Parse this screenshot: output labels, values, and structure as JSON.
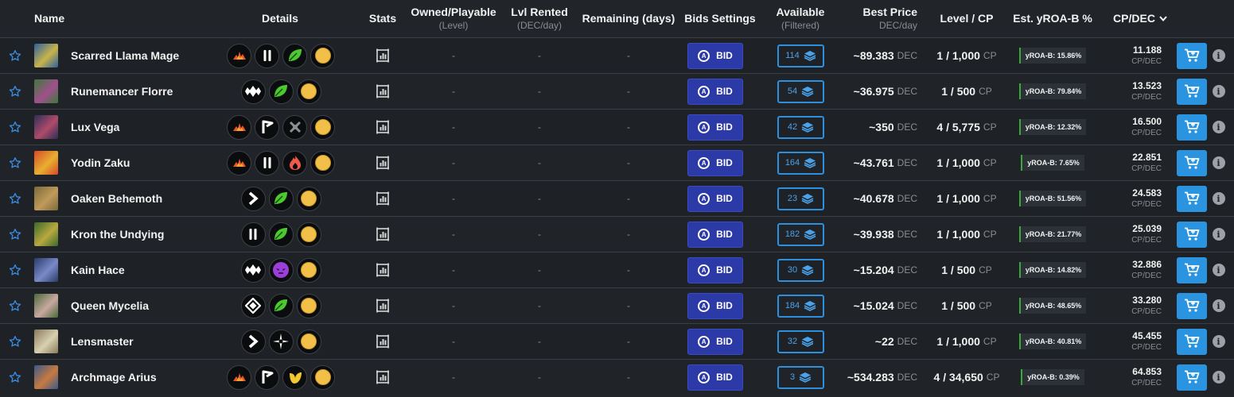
{
  "header": {
    "name": "Name",
    "details": "Details",
    "stats": "Stats",
    "owned": "Owned/Playable",
    "owned_sub": "(Level)",
    "lvl_rented": "Lvl Rented",
    "lvl_rented_sub": "(DEC/day)",
    "remaining": "Remaining (days)",
    "bids_settings": "Bids Settings",
    "available": "Available",
    "available_sub": "(Filtered)",
    "best_price": "Best Price",
    "best_price_sub": "DEC/day",
    "level_cp": "Level / CP",
    "yroa": "Est. yROA-B %",
    "cpdec": "CP/DEC"
  },
  "labels": {
    "dash": "-",
    "bid": "BID",
    "dec_unit": "DEC",
    "cp_unit": "CP",
    "cpdec_unit": "CP/DEC",
    "info": "i"
  },
  "colors": {
    "accent_blue": "#2a94e0",
    "bid_button": "#2c3aa8",
    "yroa_bar": "#3ca83c"
  },
  "rows": [
    {
      "name": "Scarred Llama Mage",
      "thumb": [
        "#2d5fa0",
        "#c8b44a"
      ],
      "icons": [
        "fire-splinter-icon",
        "attack-melee-icon",
        "earth-splinter-icon",
        "gold-rarity-icon"
      ],
      "available": "114",
      "price": "~89.383",
      "level": "1 / 1,000",
      "yroa": "yROA-B: 15.86%",
      "cpdec": "11.188"
    },
    {
      "name": "Runemancer Florre",
      "thumb": [
        "#3c7a3a",
        "#a0508c"
      ],
      "icons": [
        "magic-attack-icon",
        "earth-splinter-icon",
        "gold-rarity-icon"
      ],
      "available": "54",
      "price": "~36.975",
      "level": "1 / 500",
      "yroa": "yROA-B: 79.84%",
      "cpdec": "13.523"
    },
    {
      "name": "Lux Vega",
      "thumb": [
        "#2b2f58",
        "#b04a6a"
      ],
      "icons": [
        "fire-splinter-icon",
        "ranged-attack-icon",
        "neutral-splinter-icon",
        "gold-rarity-icon"
      ],
      "available": "42",
      "price": "~350",
      "level": "4 / 5,775",
      "yroa": "yROA-B: 12.32%",
      "cpdec": "16.500"
    },
    {
      "name": "Yodin Zaku",
      "thumb": [
        "#d8482a",
        "#e8b030"
      ],
      "icons": [
        "fire-splinter-icon",
        "attack-melee-icon",
        "fire-element-icon",
        "gold-rarity-icon"
      ],
      "available": "164",
      "price": "~43.761",
      "level": "1 / 1,000",
      "yroa": "yROA-B: 7.65%",
      "cpdec": "22.851"
    },
    {
      "name": "Oaken Behemoth",
      "thumb": [
        "#7a6a3a",
        "#c09a5a"
      ],
      "icons": [
        "speed-icon",
        "earth-splinter-icon",
        "gold-rarity-icon"
      ],
      "available": "23",
      "price": "~40.678",
      "level": "1 / 1,000",
      "yroa": "yROA-B: 51.56%",
      "cpdec": "24.583"
    },
    {
      "name": "Kron the Undying",
      "thumb": [
        "#3a6a2a",
        "#b8a840"
      ],
      "icons": [
        "attack-melee-icon",
        "earth-splinter-icon",
        "gold-rarity-icon"
      ],
      "available": "182",
      "price": "~39.938",
      "level": "1 / 1,000",
      "yroa": "yROA-B: 21.77%",
      "cpdec": "25.039"
    },
    {
      "name": "Kain Hace",
      "thumb": [
        "#2a3a6a",
        "#7a8ac8"
      ],
      "icons": [
        "magic-attack-icon",
        "death-splinter-icon",
        "gold-rarity-icon"
      ],
      "available": "30",
      "price": "~15.204",
      "level": "1 / 500",
      "yroa": "yROA-B: 14.82%",
      "cpdec": "32.886"
    },
    {
      "name": "Queen Mycelia",
      "thumb": [
        "#4a6a3a",
        "#c8a8a0"
      ],
      "icons": [
        "shield-icon",
        "earth-splinter-icon",
        "gold-rarity-icon"
      ],
      "available": "184",
      "price": "~15.024",
      "level": "1 / 500",
      "yroa": "yROA-B: 48.65%",
      "cpdec": "33.280"
    },
    {
      "name": "Lensmaster",
      "thumb": [
        "#8a7a5a",
        "#d8d0b0"
      ],
      "icons": [
        "speed-icon",
        "crosshair-icon",
        "gold-rarity-icon"
      ],
      "available": "32",
      "price": "~22",
      "level": "1 / 1,000",
      "yroa": "yROA-B: 40.81%",
      "cpdec": "45.455"
    },
    {
      "name": "Archmage Arius",
      "thumb": [
        "#3a5a8a",
        "#c87a40"
      ],
      "icons": [
        "fire-splinter-icon",
        "ranged-attack-icon",
        "life-splinter-icon",
        "gold-rarity-icon"
      ],
      "available": "3",
      "price": "~534.283",
      "level": "4 / 34,650",
      "yroa": "yROA-B: 0.39%",
      "cpdec": "64.853"
    }
  ]
}
